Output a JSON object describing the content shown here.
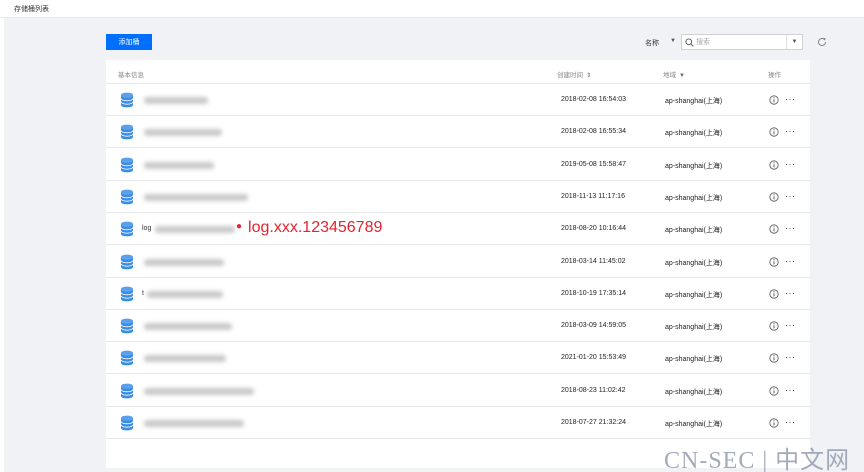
{
  "header": {
    "title": "存储桶列表"
  },
  "toolbar": {
    "add_label": "添加桶",
    "filter_label": "名称",
    "search_placeholder": "搜索"
  },
  "table": {
    "columns": {
      "base": "基本信息",
      "time": "创建时间",
      "region": "地域",
      "ops": "操作"
    },
    "rows": [
      {
        "name": "",
        "created": "2018-02-08 16:54:03",
        "region": "ap-shanghai(上海)"
      },
      {
        "name": "",
        "created": "2018-02-08 16:55:34",
        "region": "ap-shanghai(上海)"
      },
      {
        "name": "",
        "created": "2019-05-08 15:58:47",
        "region": "ap-shanghai(上海)"
      },
      {
        "name": "",
        "created": "2018-11-13 11:17:16",
        "region": "ap-shanghai(上海)"
      },
      {
        "name": "log",
        "created": "2018-08-20 10:16:44",
        "region": "ap-shanghai(上海)"
      },
      {
        "name": "",
        "created": "2018-03-14 11:45:02",
        "region": "ap-shanghai(上海)"
      },
      {
        "name": "t",
        "created": "2018-10-19 17:35:14",
        "region": "ap-shanghai(上海)"
      },
      {
        "name": "",
        "created": "2018-03-09 14:59:05",
        "region": "ap-shanghai(上海)"
      },
      {
        "name": "",
        "created": "2021-01-20 15:53:49",
        "region": "ap-shanghai(上海)"
      },
      {
        "name": "",
        "created": "2018-08-23 11:02:42",
        "region": "ap-shanghai(上海)"
      },
      {
        "name": "",
        "created": "2018-07-27 21:32:24",
        "region": "ap-shanghai(上海)"
      }
    ]
  },
  "annotation": {
    "text": "log.xxx.123456789"
  },
  "watermark": {
    "text": "CN-SEC | 中文网"
  },
  "colors": {
    "primary": "#006eff",
    "annotation": "#e6222e",
    "bucket_icon": "#3b8de4"
  },
  "icons": [
    "search-icon",
    "refresh-icon",
    "bucket-icon",
    "info-icon",
    "more-icon",
    "sort-icon",
    "filter-icon"
  ]
}
